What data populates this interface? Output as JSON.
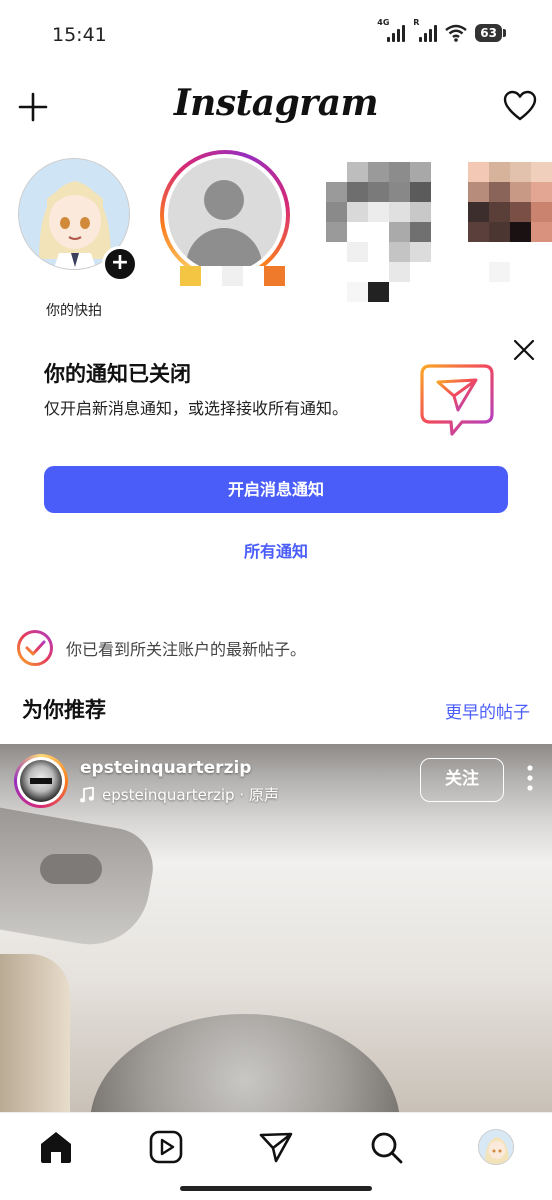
{
  "status_bar": {
    "time": "15:41",
    "network_1": "4G",
    "network_2": "R",
    "battery": "63"
  },
  "header": {
    "logo": "Instagram",
    "create_icon": "plus-icon",
    "activity_icon": "heart-icon"
  },
  "stories": {
    "my_story_label": "你的快拍"
  },
  "notification_card": {
    "title": "你的通知已关闭",
    "description": "仅开启新消息通知，或选择接收所有通知。",
    "primary_button": "开启消息通知",
    "secondary_link": "所有通知"
  },
  "caught_up": {
    "text": "你已看到所关注账户的最新帖子。"
  },
  "suggested": {
    "title": "为你推荐",
    "older_posts_link": "更早的帖子"
  },
  "post": {
    "username": "epsteinquarterzip",
    "audio": "epsteinquarterzip · 原声",
    "follow_button": "关注"
  },
  "bottom_nav": {
    "items": [
      "home-icon",
      "reels-icon",
      "direct-icon",
      "search-icon",
      "profile-avatar"
    ]
  },
  "colors": {
    "accent": "#4a5df9",
    "story_ring": [
      "#feda75",
      "#fa7e1e",
      "#d62976",
      "#962fbf"
    ]
  }
}
